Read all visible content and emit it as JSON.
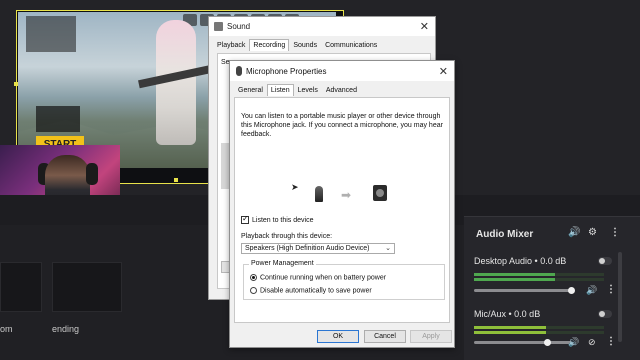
{
  "game": {
    "start_label": "START"
  },
  "scenes": {
    "left_label": "om",
    "right_label": "ending"
  },
  "audio_mixer": {
    "title": "Audio Mixer",
    "tracks": [
      {
        "name": "Desktop Audio",
        "level": "0.0 dB",
        "meter_level": 0.62
      },
      {
        "name": "Mic/Aux",
        "level": "0.0 dB",
        "meter_level": 0.55
      }
    ],
    "icons": [
      "speaker-icon",
      "gear-icon",
      "more-icon",
      "lock-icon"
    ]
  },
  "sound_dialog": {
    "title": "Sound",
    "tabs": [
      "Playback",
      "Recording",
      "Sounds",
      "Communications"
    ],
    "active_tab": "Recording",
    "fragment": "Se"
  },
  "mic_dialog": {
    "title": "Microphone Properties",
    "tabs": [
      "General",
      "Listen",
      "Levels",
      "Advanced"
    ],
    "active_tab": "Listen",
    "description": "You can listen to a portable music player or other device through this Microphone jack.  If you connect a microphone, you may hear feedback.",
    "listen_checkbox": {
      "label": "Listen to this device",
      "checked": true
    },
    "playback_label": "Playback through this device:",
    "playback_device": "Speakers (High Definition Audio Device)",
    "power_management": {
      "legend": "Power Management",
      "options": [
        {
          "label": "Continue running when on battery power",
          "selected": true
        },
        {
          "label": "Disable automatically to save power",
          "selected": false
        }
      ]
    },
    "buttons": {
      "ok": "OK",
      "cancel": "Cancel",
      "apply": "Apply"
    }
  }
}
